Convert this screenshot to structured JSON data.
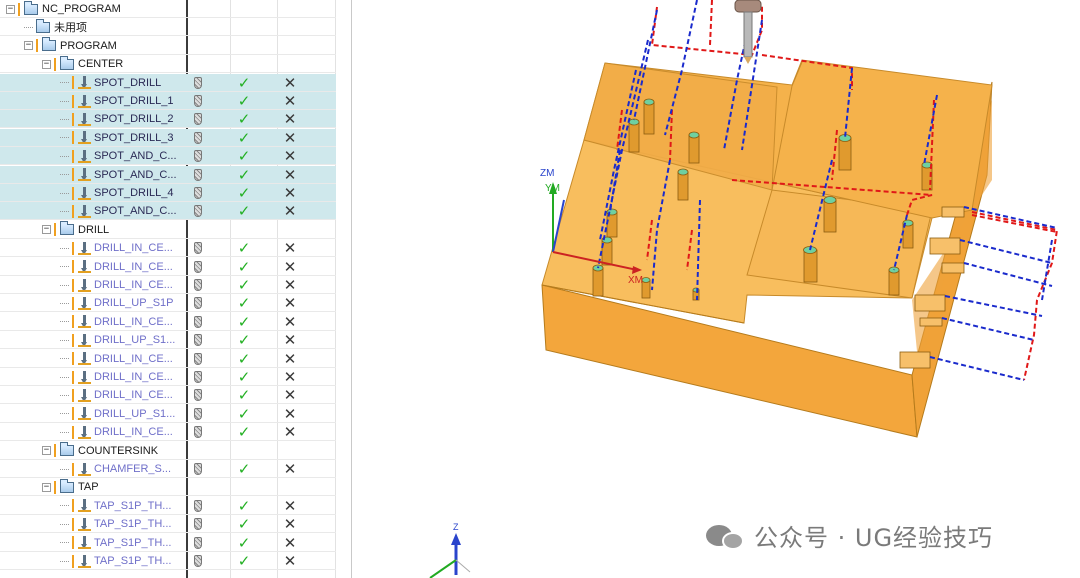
{
  "tree": {
    "rows": [
      {
        "label": "NC_PROGRAM",
        "kind": "group",
        "indent": 0,
        "expander": "-"
      },
      {
        "label": "未用项",
        "kind": "group",
        "indent": 1,
        "expander": ""
      },
      {
        "label": "PROGRAM",
        "kind": "group",
        "indent": 1,
        "expander": "-"
      },
      {
        "label": "CENTER",
        "kind": "group",
        "indent": 2,
        "expander": "-"
      },
      {
        "label": "SPOT_DRILL",
        "kind": "op",
        "indent": 3,
        "highlight": true,
        "dark": true
      },
      {
        "label": "SPOT_DRILL_1",
        "kind": "op",
        "indent": 3,
        "highlight": true,
        "dark": true
      },
      {
        "label": "SPOT_DRILL_2",
        "kind": "op",
        "indent": 3,
        "highlight": true,
        "dark": true
      },
      {
        "label": "SPOT_DRILL_3",
        "kind": "op",
        "indent": 3,
        "highlight": true,
        "dark": true
      },
      {
        "label": "SPOT_AND_C...",
        "kind": "op",
        "indent": 3,
        "highlight": true,
        "dark": true
      },
      {
        "label": "SPOT_AND_C...",
        "kind": "op",
        "indent": 3,
        "highlight": true,
        "dark": true
      },
      {
        "label": "SPOT_DRILL_4",
        "kind": "op",
        "indent": 3,
        "highlight": true,
        "dark": true
      },
      {
        "label": "SPOT_AND_C...",
        "kind": "op",
        "indent": 3,
        "highlight": true,
        "dark": true
      },
      {
        "label": "DRILL",
        "kind": "group",
        "indent": 2,
        "expander": "-"
      },
      {
        "label": "DRILL_IN_CE...",
        "kind": "op",
        "indent": 3
      },
      {
        "label": "DRILL_IN_CE...",
        "kind": "op",
        "indent": 3
      },
      {
        "label": "DRILL_IN_CE...",
        "kind": "op",
        "indent": 3
      },
      {
        "label": "DRILL_UP_S1P",
        "kind": "op",
        "indent": 3
      },
      {
        "label": "DRILL_IN_CE...",
        "kind": "op",
        "indent": 3
      },
      {
        "label": "DRILL_UP_S1...",
        "kind": "op",
        "indent": 3
      },
      {
        "label": "DRILL_IN_CE...",
        "kind": "op",
        "indent": 3
      },
      {
        "label": "DRILL_IN_CE...",
        "kind": "op",
        "indent": 3
      },
      {
        "label": "DRILL_IN_CE...",
        "kind": "op",
        "indent": 3
      },
      {
        "label": "DRILL_UP_S1...",
        "kind": "op",
        "indent": 3
      },
      {
        "label": "DRILL_IN_CE...",
        "kind": "op",
        "indent": 3
      },
      {
        "label": "COUNTERSINK",
        "kind": "group",
        "indent": 2,
        "expander": "-"
      },
      {
        "label": "CHAMFER_S...",
        "kind": "op",
        "indent": 3
      },
      {
        "label": "TAP",
        "kind": "group",
        "indent": 2,
        "expander": "-"
      },
      {
        "label": "TAP_S1P_TH...",
        "kind": "op",
        "indent": 3
      },
      {
        "label": "TAP_S1P_TH...",
        "kind": "op",
        "indent": 3
      },
      {
        "label": "TAP_S1P_TH...",
        "kind": "op",
        "indent": 3
      },
      {
        "label": "TAP_S1P_TH...",
        "kind": "op",
        "indent": 3
      }
    ],
    "status_symbols": {
      "check": "✓",
      "cross": "✕"
    }
  },
  "viewport": {
    "wcs_labels": {
      "zm": "ZM",
      "ym": "YM",
      "xm": "XM"
    },
    "triad_label": "Z"
  },
  "watermark": {
    "text": "公众号 · UG经验技巧"
  },
  "colors": {
    "part_fill": "#f5b04a",
    "path_red": "#e01818",
    "path_blue": "#1a2acc",
    "selection_highlight": "#cfe8ec",
    "check_green": "#23b023"
  },
  "icons": [
    "folder-icon",
    "operation-icon",
    "tool-icon",
    "check-icon",
    "cross-icon",
    "expander-icon"
  ]
}
